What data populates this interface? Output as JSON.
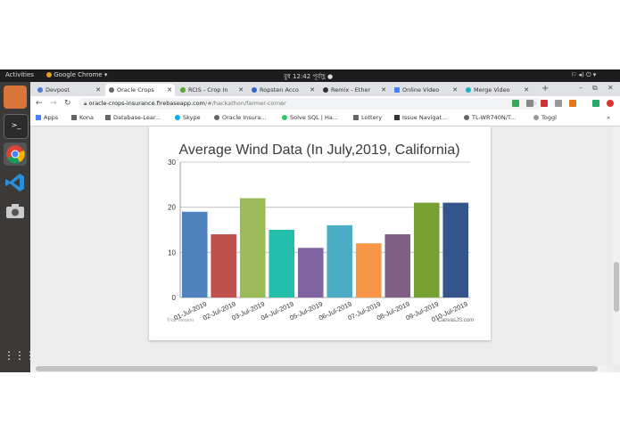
{
  "topbar": {
    "activities": "Activities",
    "app": "Google Chrome ▾",
    "clock": "বুধ 12:42 পূর্বাহ্ণ ●",
    "status_icons": "⚐ ◂) ⏻ ▾"
  },
  "tabs": [
    {
      "label": "Devpost",
      "color": "#4a7bd0"
    },
    {
      "label": "Oracle Crops",
      "color": "#666666"
    },
    {
      "label": "RCIS - Crop In",
      "color": "#55a630"
    },
    {
      "label": "Ropsten Acco",
      "color": "#3366cc"
    },
    {
      "label": "Remix - Ether",
      "color": "#333333"
    },
    {
      "label": "Online Video",
      "color": "#4285f4"
    },
    {
      "label": "Merge Video",
      "color": "#19b3c4"
    }
  ],
  "address": {
    "domain": "oracle-crops-insurance.firebaseapp.com",
    "path": "/#/hackathon/farmer-corner"
  },
  "bookmarks": [
    {
      "label": "Apps",
      "icon": "apps-grid-icon"
    },
    {
      "label": "Kona",
      "icon": "folder-icon"
    },
    {
      "label": "Database-Lear...",
      "icon": "folder-icon"
    },
    {
      "label": "Skype",
      "icon": "skype-icon"
    },
    {
      "label": "Oracle Insura...",
      "icon": "globe-icon"
    },
    {
      "label": "Solve SQL | Ha...",
      "icon": "hackerrank-icon"
    },
    {
      "label": "Lottery",
      "icon": "folder-icon"
    },
    {
      "label": "Issue Navigat...",
      "icon": "jira-icon"
    },
    {
      "label": "TL-WR740N/T...",
      "icon": "globe-icon"
    },
    {
      "label": "Toggl",
      "icon": "toggl-icon"
    }
  ],
  "chart_data": {
    "type": "bar",
    "title": "Average Wind Data (In July,2019, California)",
    "categories": [
      "01-Jul-2019",
      "02-Jul-2019",
      "03-Jul-2019",
      "04-Jul-2019",
      "05-Jul-2019",
      "06-Jul-2019",
      "07-Jul-2019",
      "08-Jul-2019",
      "09-Jul-2019",
      "010-Jul-2019"
    ],
    "values": [
      19,
      14,
      22,
      15,
      11,
      16,
      12,
      14,
      21,
      21
    ],
    "colors": [
      "#4f81bc",
      "#c0504e",
      "#9bbb58",
      "#23bfaa",
      "#8064a1",
      "#4aacc5",
      "#f79647",
      "#7f6084",
      "#77a033",
      "#33558b"
    ],
    "ylim": [
      0,
      30
    ],
    "yticks": [
      0,
      10,
      20,
      30
    ],
    "xlabel": "",
    "ylabel": "",
    "grid": true,
    "trial_text": "Trial Version",
    "credit": "CanvasJS.com"
  }
}
